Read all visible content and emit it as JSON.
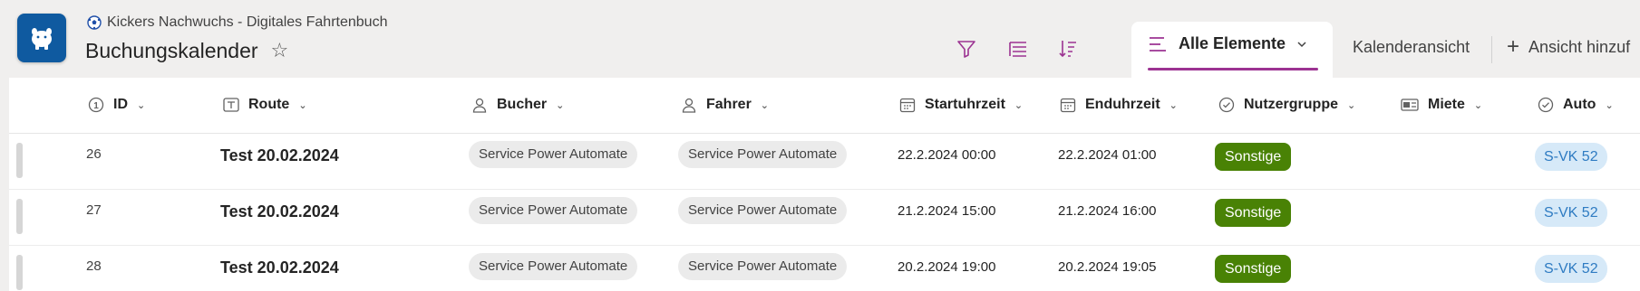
{
  "site": {
    "name": "Kickers Nachwuchs - Digitales Fahrtenbuch",
    "icon": "soccer-ball-icon"
  },
  "page": {
    "title": "Buchungskalender",
    "favorite_icon": "star-outline-icon",
    "app_icon": "piggy-bank-icon"
  },
  "command_bar": {
    "icons": [
      "filter-icon",
      "group-by-icon",
      "sort-icon"
    ]
  },
  "views": {
    "active": {
      "label": "Alle Elemente",
      "icon": "list-view-icon"
    },
    "calendar_label": "Kalenderansicht",
    "add_label": "Ansicht hinzuf"
  },
  "columns": [
    {
      "label": "ID",
      "icon": "number-icon"
    },
    {
      "label": "Route",
      "icon": "text-icon"
    },
    {
      "label": "Bucher",
      "icon": "person-icon"
    },
    {
      "label": "Fahrer",
      "icon": "person-icon"
    },
    {
      "label": "Startuhrzeit",
      "icon": "calendar-icon"
    },
    {
      "label": "Enduhrzeit",
      "icon": "calendar-icon"
    },
    {
      "label": "Nutzergruppe",
      "icon": "choice-icon"
    },
    {
      "label": "Miete",
      "icon": "currency-icon"
    },
    {
      "label": "Auto",
      "icon": "choice-icon"
    }
  ],
  "rows": [
    {
      "id": "26",
      "route": "Test 20.02.2024",
      "bucher": "Service Power Automate",
      "fahrer": "Service Power Automate",
      "start": "22.2.2024 00:00",
      "end": "22.2.2024 01:00",
      "gruppe": "Sonstige",
      "miete": "",
      "auto": "S-VK 52"
    },
    {
      "id": "27",
      "route": "Test 20.02.2024",
      "bucher": "Service Power Automate",
      "fahrer": "Service Power Automate",
      "start": "21.2.2024 15:00",
      "end": "21.2.2024 16:00",
      "gruppe": "Sonstige",
      "miete": "",
      "auto": "S-VK 52"
    },
    {
      "id": "28",
      "route": "Test 20.02.2024",
      "bucher": "Service Power Automate",
      "fahrer": "Service Power Automate",
      "start": "20.2.2024 19:00",
      "end": "20.2.2024 19:05",
      "gruppe": "Sonstige",
      "miete": "",
      "auto": "S-VK 52"
    }
  ],
  "colors": {
    "accent": "#9c3392",
    "app_tile": "#0f5aa0",
    "badge_green": "#498205",
    "badge_blue_bg": "#d6e9f8",
    "badge_blue_text": "#2e7bc2"
  }
}
